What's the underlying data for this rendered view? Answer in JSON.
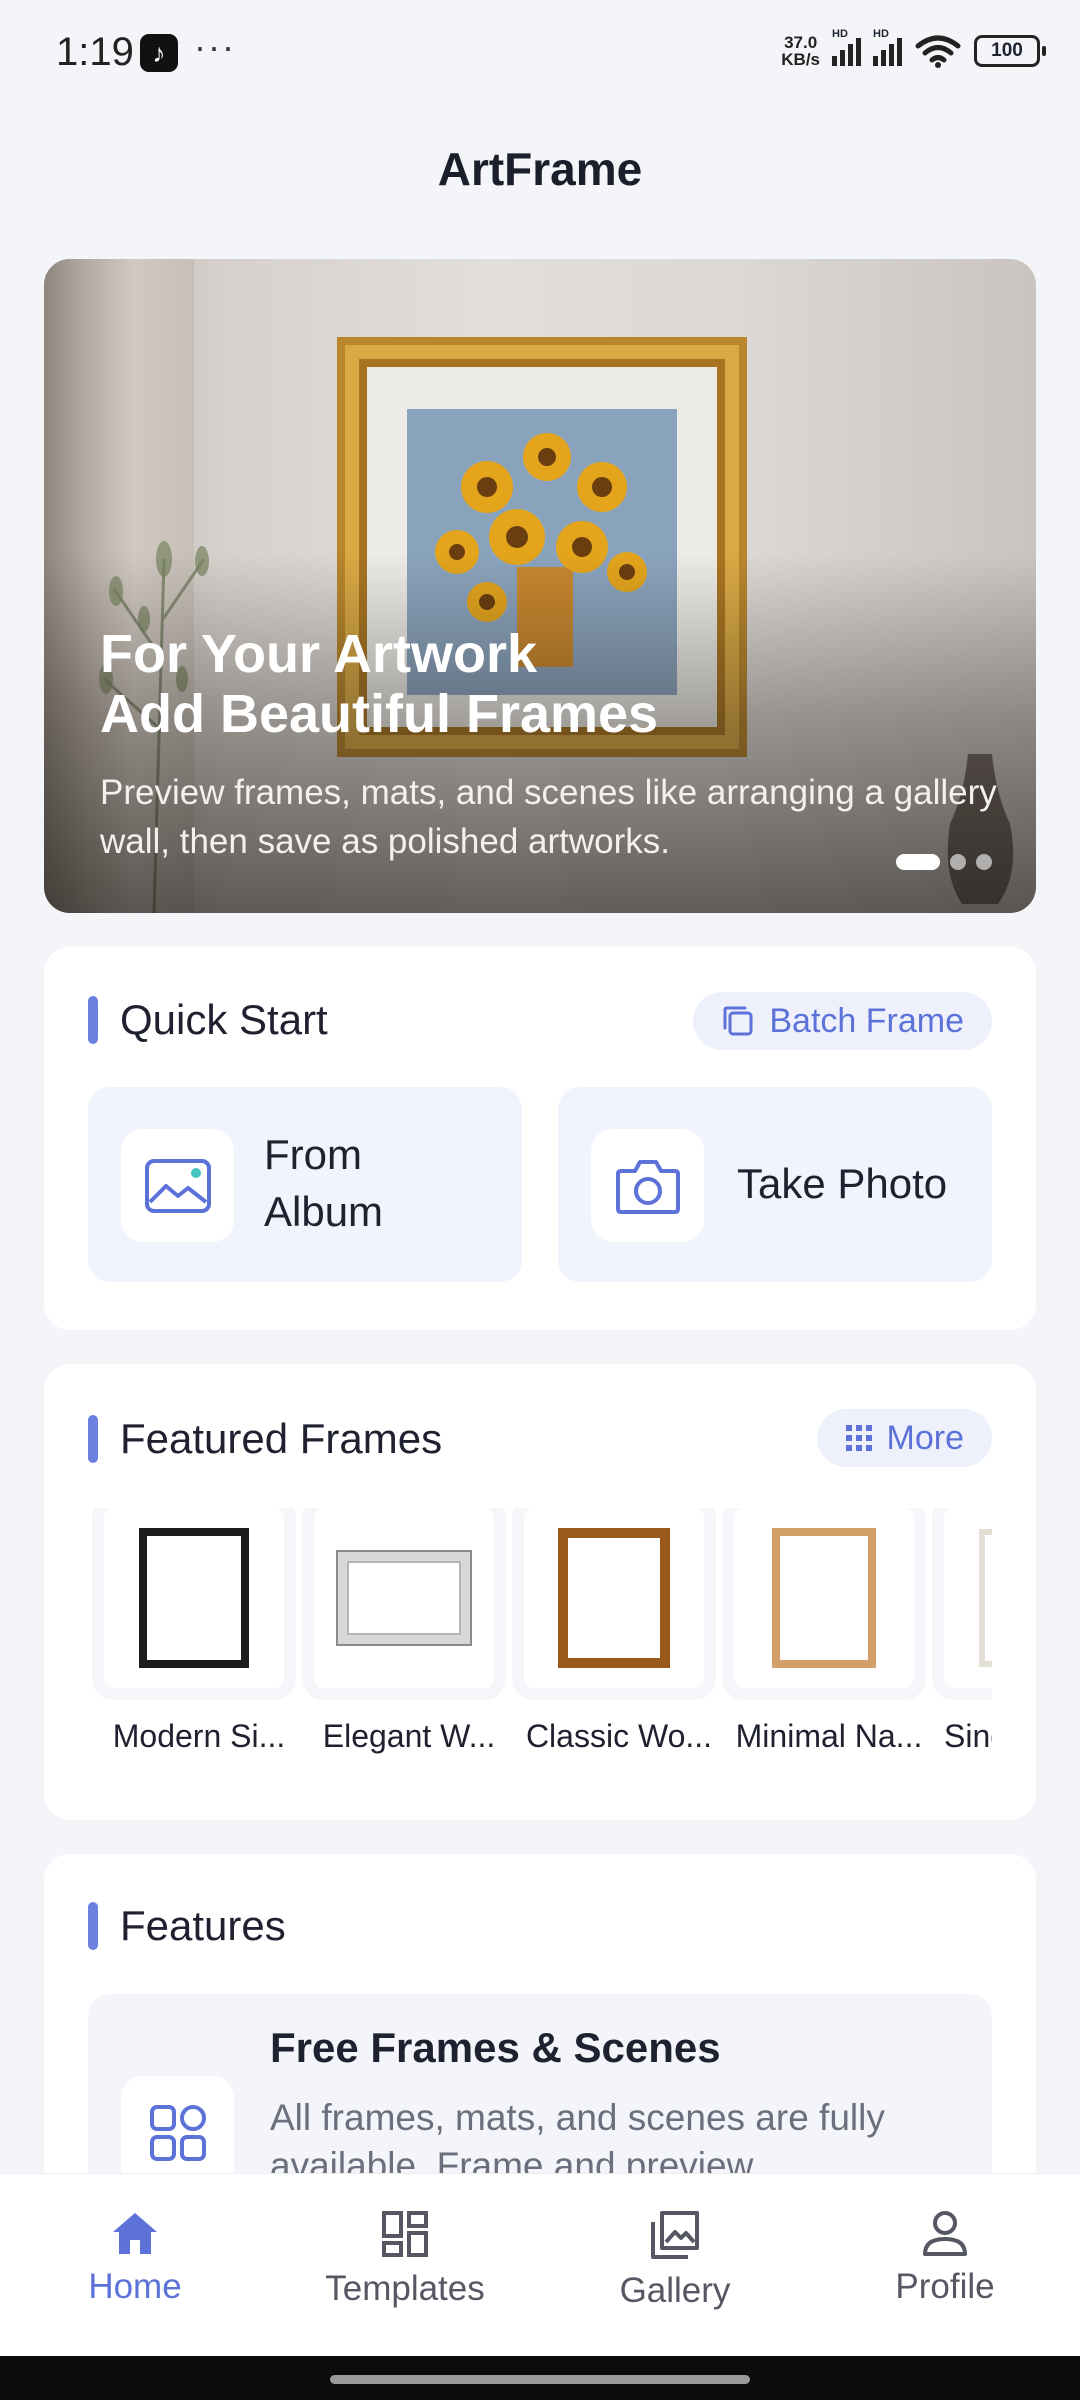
{
  "status_bar": {
    "time": "1:19",
    "more": "···",
    "net_speed_value": "37.0",
    "net_speed_unit": "KB/s",
    "hd": "HD",
    "battery": "100"
  },
  "app": {
    "title": "ArtFrame"
  },
  "hero": {
    "title_line1": "For Your Artwork",
    "title_line2": "Add Beautiful Frames",
    "subtitle": "Preview frames, mats, and scenes like arranging a gallery wall, then save as polished artworks.",
    "slides_total": 3,
    "slide_active": 1
  },
  "quick_start": {
    "title": "Quick Start",
    "batch_label": "Batch Frame",
    "from_album_line1": "From",
    "from_album_line2": "Album",
    "take_photo": "Take Photo"
  },
  "featured": {
    "title": "Featured Frames",
    "more_label": "More",
    "frames": [
      {
        "name": "Modern Si..."
      },
      {
        "name": "Elegant W..."
      },
      {
        "name": "Classic Wo..."
      },
      {
        "name": "Minimal Na..."
      },
      {
        "name": "Sing"
      }
    ]
  },
  "features": {
    "title": "Features",
    "item_title": "Free Frames & Scenes",
    "item_desc": "All frames, mats, and scenes are fully available. Frame and preview"
  },
  "nav": {
    "home": "Home",
    "templates": "Templates",
    "gallery": "Gallery",
    "profile": "Profile"
  },
  "colors": {
    "accent": "#5c72d8",
    "background": "#f4f5f9",
    "tile": "#f1f3fd"
  }
}
